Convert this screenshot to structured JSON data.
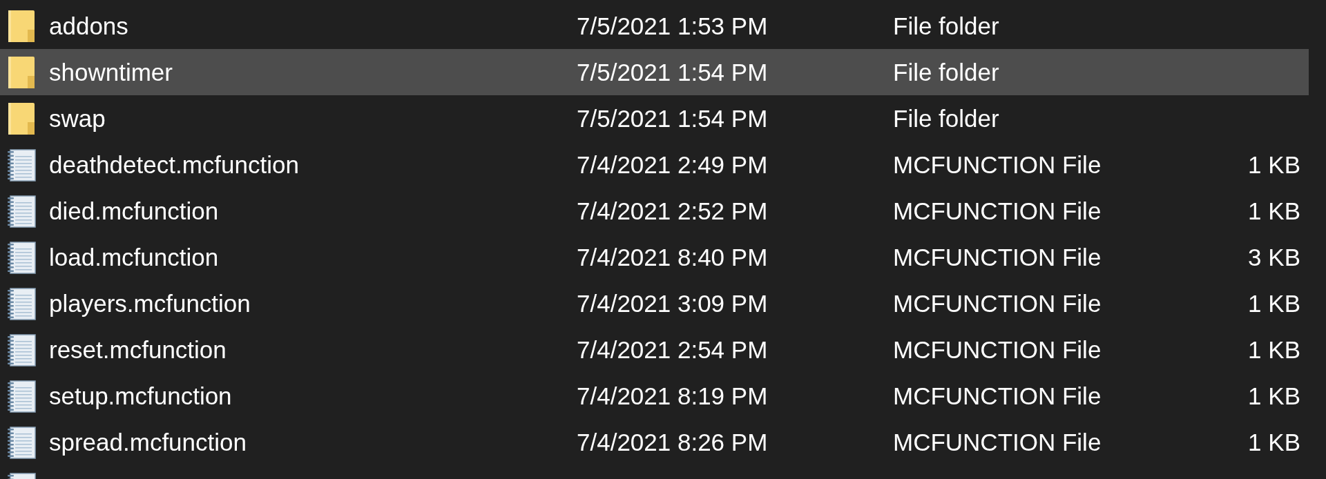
{
  "files": [
    {
      "kind": "folder",
      "name": "addons",
      "date_modified": "7/5/2021 1:53 PM",
      "type": "File folder",
      "selected": false
    },
    {
      "kind": "folder",
      "name": "showntimer",
      "date_modified": "7/5/2021 1:54 PM",
      "type": "File folder",
      "selected": true
    },
    {
      "kind": "folder",
      "name": "swap",
      "date_modified": "7/5/2021 1:54 PM",
      "type": "File folder",
      "selected": false
    },
    {
      "kind": "file",
      "name": "deathdetect.mcfunction",
      "date_modified": "7/4/2021 2:49 PM",
      "type": "MCFUNCTION File",
      "size": "1 KB",
      "selected": false
    },
    {
      "kind": "file",
      "name": "died.mcfunction",
      "date_modified": "7/4/2021 2:52 PM",
      "type": "MCFUNCTION File",
      "size": "1 KB",
      "selected": false
    },
    {
      "kind": "file",
      "name": "load.mcfunction",
      "date_modified": "7/4/2021 8:40 PM",
      "type": "MCFUNCTION File",
      "size": "3 KB",
      "selected": false
    },
    {
      "kind": "file",
      "name": "players.mcfunction",
      "date_modified": "7/4/2021 3:09 PM",
      "type": "MCFUNCTION File",
      "size": "1 KB",
      "selected": false
    },
    {
      "kind": "file",
      "name": "reset.mcfunction",
      "date_modified": "7/4/2021 2:54 PM",
      "type": "MCFUNCTION File",
      "size": "1 KB",
      "selected": false
    },
    {
      "kind": "file",
      "name": "setup.mcfunction",
      "date_modified": "7/4/2021 8:19 PM",
      "type": "MCFUNCTION File",
      "size": "1 KB",
      "selected": false
    },
    {
      "kind": "file",
      "name": "spread.mcfunction",
      "date_modified": "7/4/2021 8:26 PM",
      "type": "MCFUNCTION File",
      "size": "1 KB",
      "selected": false
    },
    {
      "kind": "file",
      "selected": false
    }
  ]
}
